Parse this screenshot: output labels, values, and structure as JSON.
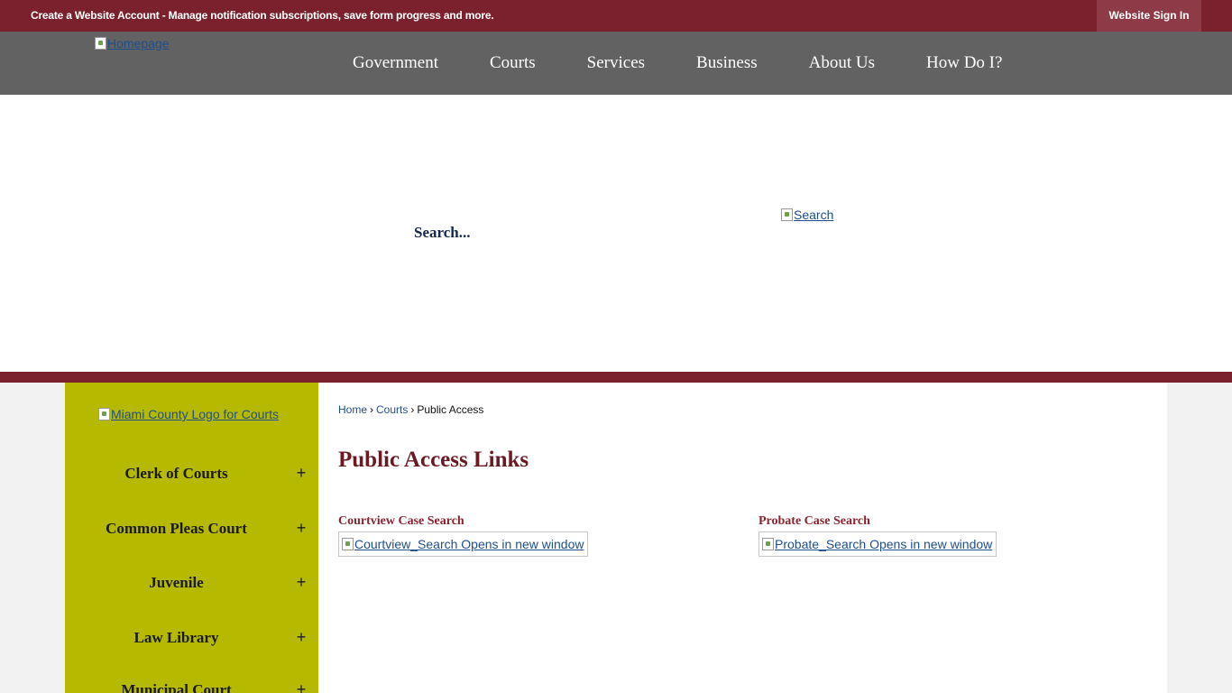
{
  "topbar": {
    "account_bold": "Create a Website Account",
    "account_rest": " - Manage notification subscriptions, save form progress and more.",
    "signin_label": "Website Sign In"
  },
  "header": {
    "logo_alt": "Homepage",
    "nav": [
      "Government",
      "Courts",
      "Services",
      "Business",
      "About Us",
      "How Do I?"
    ]
  },
  "search": {
    "placeholder": "Search...",
    "button_alt": "Search"
  },
  "sidebar": {
    "logo_alt": "Miami County Logo for Courts",
    "items": [
      {
        "label": "Clerk of Courts",
        "expander": "+"
      },
      {
        "label": "Common Pleas Court",
        "expander": "+"
      },
      {
        "label": "Juvenile",
        "expander": "+"
      },
      {
        "label": "Law Library",
        "expander": "+"
      },
      {
        "label": "Municipal Court",
        "expander": "+"
      }
    ]
  },
  "breadcrumb": {
    "home": "Home",
    "courts": "Courts",
    "current": "Public Access",
    "separator": "›"
  },
  "main": {
    "title": "Public Access Links",
    "links": [
      {
        "heading": "Courtview Case Search",
        "image_alt": "Courtview_Search Opens in new window"
      },
      {
        "heading": "Probate Case Search",
        "image_alt": "Probate_Search Opens in new window"
      }
    ]
  },
  "colors": {
    "brand_maroon": "#7b212e",
    "nav_gray": "#626262",
    "sidebar_olive": "#b5b900",
    "title_maroon": "#6b1a24"
  }
}
